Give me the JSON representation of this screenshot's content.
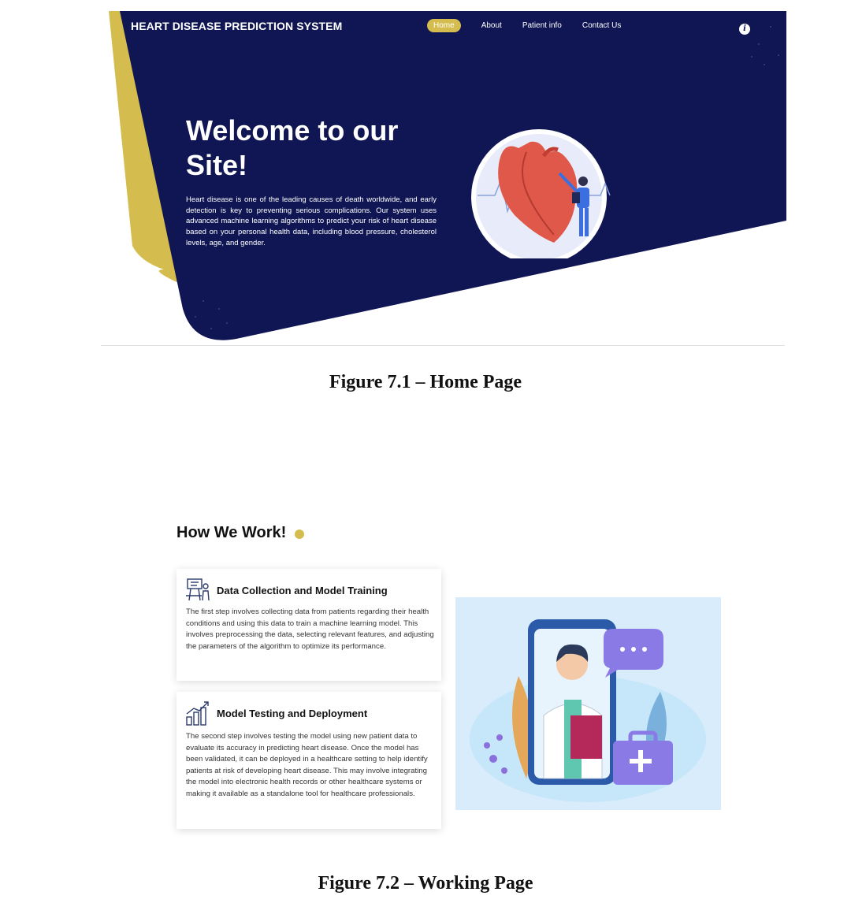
{
  "hero": {
    "brand": "HEART DISEASE PREDICTION SYSTEM",
    "nav": [
      "Home",
      "About",
      "Patient info",
      "Contact Us"
    ],
    "active_nav": "Home",
    "info_icon": "i",
    "title": "Welcome to our Site!",
    "description": "Heart disease is one of the leading causes of death worldwide, and early detection is key to preventing serious complications. Our system uses advanced machine learning algorithms to predict your risk of heart disease based on your personal health data, including blood pressure, cholesterol levels, age, and gender.",
    "colors": {
      "navy": "#0f1653",
      "gold": "#d4bd4e"
    }
  },
  "captions": {
    "figure1": "Figure 7.1 – Home Page",
    "figure2": "Figure 7.2 – Working Page"
  },
  "work": {
    "title": "How We Work!",
    "cards": [
      {
        "icon": "training-icon",
        "title": "Data Collection and Model Training",
        "text": "The first step involves collecting data from patients regarding their health conditions and using this data to train a machine learning model. This involves preprocessing the data, selecting relevant features, and adjusting the parameters of the algorithm to optimize its performance."
      },
      {
        "icon": "growth-chart-icon",
        "title": "Model Testing and Deployment",
        "text": "The second step involves testing the model using new patient data to evaluate its accuracy in predicting heart disease. Once the model has been validated, it can be deployed in a healthcare setting to help identify patients at risk of developing heart disease. This may involve integrating the model into electronic health records or other healthcare systems or making it available as a standalone tool for healthcare professionals."
      }
    ]
  }
}
